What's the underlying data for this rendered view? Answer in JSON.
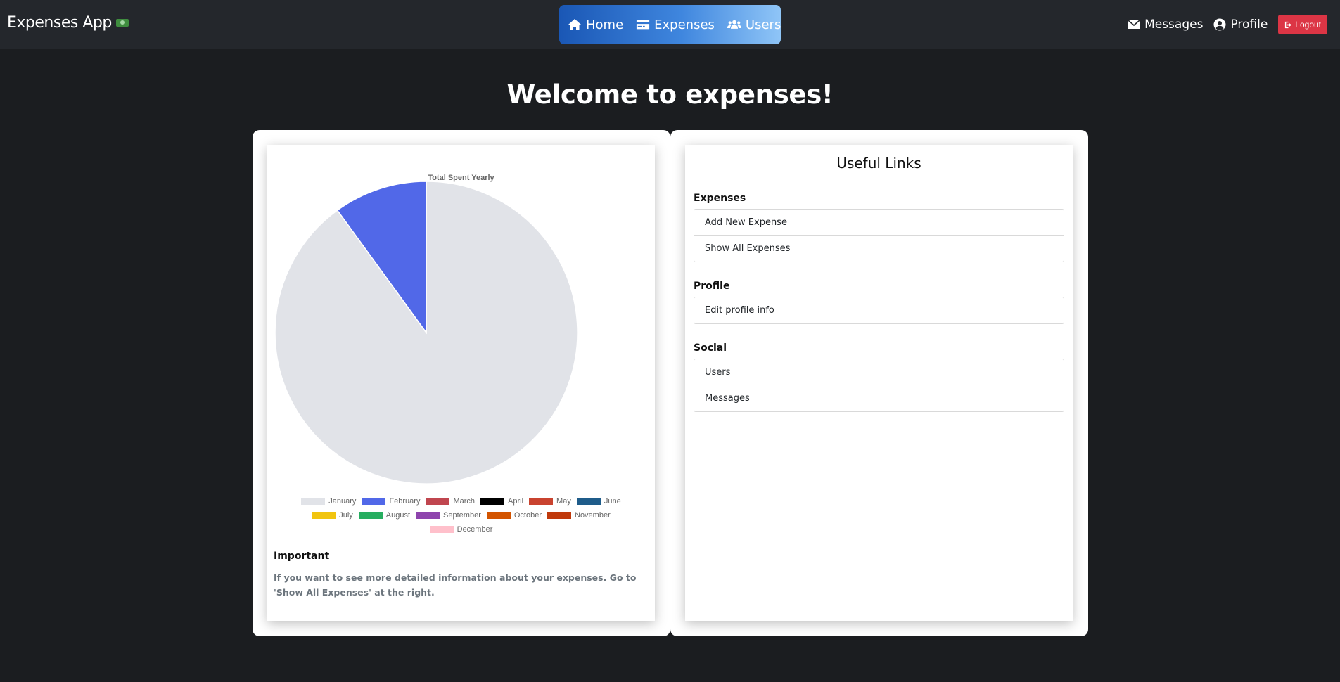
{
  "navbar": {
    "brand": "Expenses App",
    "center": [
      {
        "label": "Home",
        "icon": "home-icon"
      },
      {
        "label": "Expenses",
        "icon": "credit-card-icon"
      },
      {
        "label": "Users",
        "icon": "users-icon"
      }
    ],
    "messages_label": "Messages",
    "profile_label": "Profile",
    "logout_label": "Logout"
  },
  "page": {
    "title": "Welcome to expenses!"
  },
  "chart_data": {
    "type": "pie",
    "title": "Total Spent Yearly",
    "categories": [
      "January",
      "February",
      "March",
      "April",
      "May",
      "June",
      "July",
      "August",
      "September",
      "October",
      "November",
      "December"
    ],
    "values": [
      90,
      10,
      0,
      0,
      0,
      0,
      0,
      0,
      0,
      0,
      0,
      0
    ],
    "colors": [
      "#e1e3e8",
      "#5168e8",
      "#c0464f",
      "#000000",
      "#c9432f",
      "#1f5c8a",
      "#f1c40f",
      "#27ae60",
      "#8e44ad",
      "#d35400",
      "#c0390b",
      "#ffc0cb"
    ],
    "legend": "bottom"
  },
  "important": {
    "heading": "Important",
    "text": "If you want to see more detailed information about your expenses. Go to 'Show All Expenses' at the right."
  },
  "links": {
    "title": "Useful Links",
    "sections": [
      {
        "heading": "Expenses",
        "items": [
          "Add New Expense",
          "Show All Expenses"
        ]
      },
      {
        "heading": "Profile",
        "items": [
          "Edit profile info"
        ]
      },
      {
        "heading": "Social",
        "items": [
          "Users",
          "Messages"
        ]
      }
    ]
  }
}
